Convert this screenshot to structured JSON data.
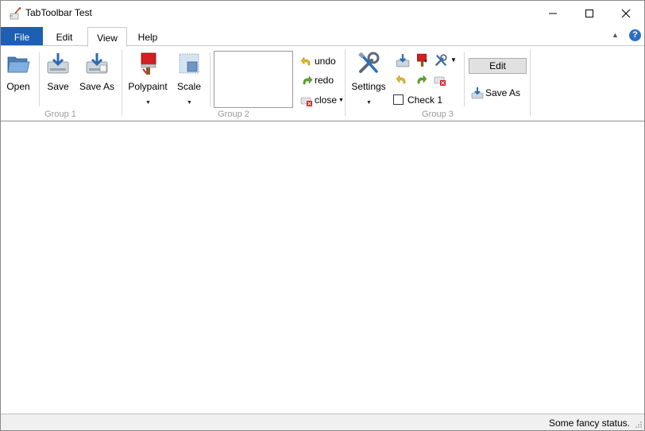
{
  "window": {
    "title": "TabToolbar Test",
    "controls": [
      "minimize-icon",
      "maximize-icon",
      "close-icon"
    ]
  },
  "tabs": [
    {
      "label": "File",
      "active": false
    },
    {
      "label": "Edit",
      "active": false
    },
    {
      "label": "View",
      "active": true
    },
    {
      "label": "Help",
      "active": false
    }
  ],
  "ribbon": {
    "group1": {
      "label": "Group 1",
      "buttons": [
        {
          "label": "Open",
          "icon": "folder-open-icon"
        },
        {
          "label": "Save",
          "icon": "save-icon"
        },
        {
          "label": "Save As",
          "icon": "save-as-icon"
        }
      ]
    },
    "group2": {
      "label": "Group 2",
      "buttons": [
        {
          "label": "Polypaint",
          "icon": "paint-bucket-icon"
        },
        {
          "label": "Scale",
          "icon": "scale-icon"
        }
      ],
      "small": [
        {
          "label": "undo",
          "icon": "undo-icon"
        },
        {
          "label": "redo",
          "icon": "redo-icon"
        },
        {
          "label": "close",
          "icon": "close-doc-icon"
        }
      ]
    },
    "group3": {
      "label": "Group 3",
      "settings_label": "Settings",
      "check_label": "Check 1",
      "check_checked": false
    },
    "extra": {
      "edit_label": "Edit",
      "save_as_label": "Save As"
    }
  },
  "status": {
    "text": "Some fancy status."
  },
  "colors": {
    "file_tab": "#1c5fb3",
    "help_icon": "#2b6fc2"
  }
}
